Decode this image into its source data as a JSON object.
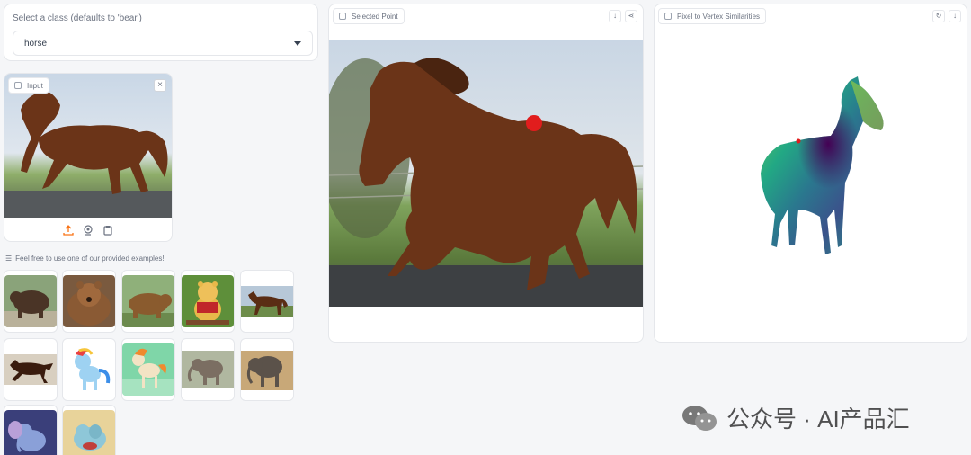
{
  "class_selector": {
    "label": "Select a class (defaults to 'bear')",
    "value": "horse"
  },
  "input": {
    "label": "Input",
    "close_icon": "close-icon",
    "tools": [
      "upload-icon",
      "webcam-icon",
      "clipboard-icon"
    ]
  },
  "examples": {
    "label": "Feel free to use one of our provided examples!",
    "items": [
      {
        "name": "bear-1"
      },
      {
        "name": "bear-2"
      },
      {
        "name": "bear-3"
      },
      {
        "name": "pooh"
      },
      {
        "name": "horse-fence"
      },
      {
        "name": "horse-running"
      },
      {
        "name": "rainbow-dash"
      },
      {
        "name": "ponyta"
      },
      {
        "name": "elephant-1"
      },
      {
        "name": "elephant-2"
      },
      {
        "name": "dumbo"
      },
      {
        "name": "phanpy"
      }
    ]
  },
  "selected_point": {
    "label": "Selected Point",
    "marker_color": "#e11d1d"
  },
  "similarities": {
    "label": "Pixel to Vertex Similarities"
  },
  "watermark": {
    "text": "公众号 · AI产品汇"
  },
  "colors": {
    "accent": "#f97316",
    "horse_brown": "#6b3418",
    "viridis_low": "#440154",
    "viridis_mid": "#21918c",
    "viridis_high": "#fde725"
  }
}
